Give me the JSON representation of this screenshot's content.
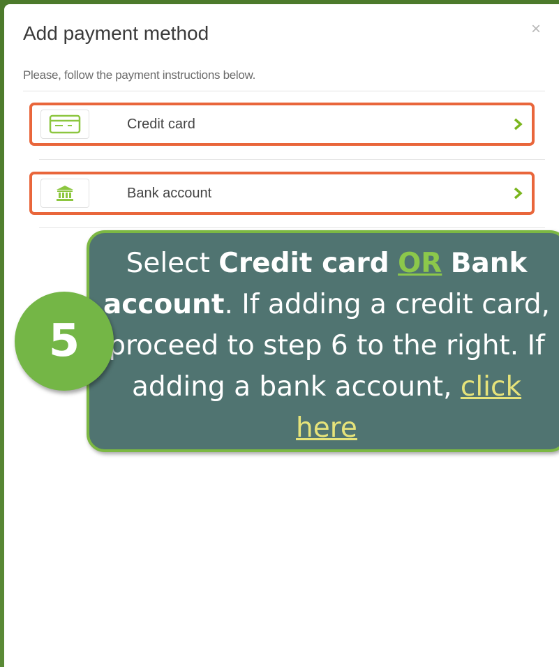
{
  "modal": {
    "title": "Add payment method",
    "close_glyph": "×",
    "instructions": "Please, follow the payment instructions below."
  },
  "options": [
    {
      "label": "Credit card",
      "icon": "credit-card-icon"
    },
    {
      "label": "Bank account",
      "icon": "bank-icon"
    }
  ],
  "callout": {
    "step_number": "5",
    "t1": "Select ",
    "b1": "Credit card",
    "t2": " ",
    "or": "OR",
    "t3": " ",
    "b2": "Bank account",
    "t4": ". If adding a credit card, proceed to step 6 to the right. If adding a bank account, ",
    "link": "click here"
  },
  "colors": {
    "accent_green": "#7cb843",
    "highlight_orange": "#e9663b",
    "callout_bg": "#507471",
    "link_yellow": "#e6e37a"
  }
}
